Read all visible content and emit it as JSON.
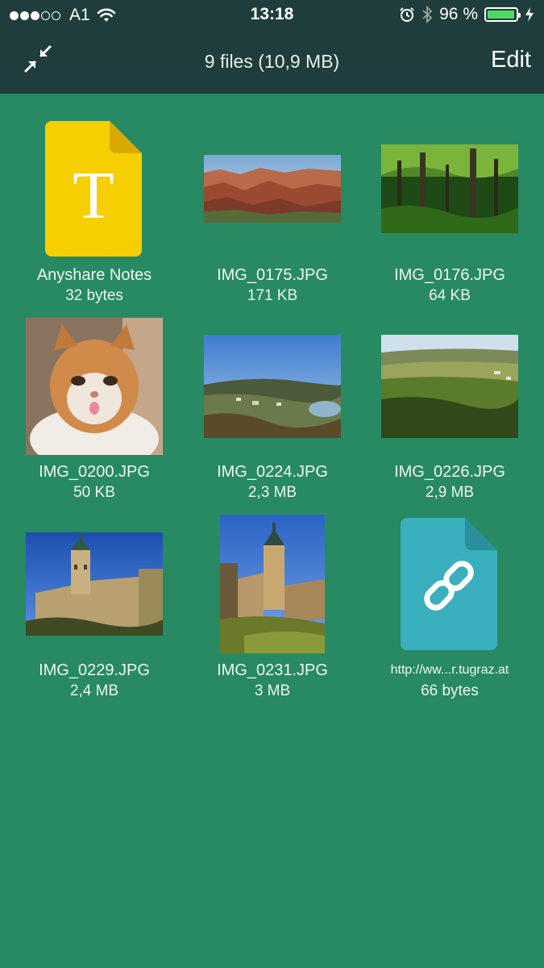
{
  "status_bar": {
    "carrier": "A1",
    "time": "13:18",
    "battery_percent": "96 %",
    "battery_level": 0.96,
    "signal_dots_filled": 3,
    "signal_dots_total": 5
  },
  "nav": {
    "title": "9 files (10,9 MB)",
    "edit_label": "Edit",
    "collapse_icon": "collapse-arrows-icon"
  },
  "colors": {
    "header_bg": "#1f3d3c",
    "content_bg": "#278a63",
    "notes_file": "#f7cf00",
    "link_file": "#3aafbd",
    "battery_fill": "#4cd964"
  },
  "files": [
    {
      "name": "Anyshare Notes",
      "size": "32 bytes",
      "type": "text",
      "icon_letter": "T"
    },
    {
      "name": "IMG_0175.JPG",
      "size": "171 KB",
      "type": "image",
      "thumb": "canyon"
    },
    {
      "name": "IMG_0176.JPG",
      "size": "64 KB",
      "type": "image",
      "thumb": "forest"
    },
    {
      "name": "IMG_0200.JPG",
      "size": "50 KB",
      "type": "image",
      "thumb": "cat"
    },
    {
      "name": "IMG_0224.JPG",
      "size": "2,3 MB",
      "type": "image",
      "thumb": "town-lake"
    },
    {
      "name": "IMG_0226.JPG",
      "size": "2,9 MB",
      "type": "image",
      "thumb": "valley"
    },
    {
      "name": "IMG_0229.JPG",
      "size": "2,4 MB",
      "type": "image",
      "thumb": "castle"
    },
    {
      "name": "IMG_0231.JPG",
      "size": "3 MB",
      "type": "image",
      "thumb": "castle-tower"
    },
    {
      "name": "http://ww...r.tugraz.at",
      "size": "66 bytes",
      "type": "link",
      "icon": "link-icon"
    }
  ]
}
